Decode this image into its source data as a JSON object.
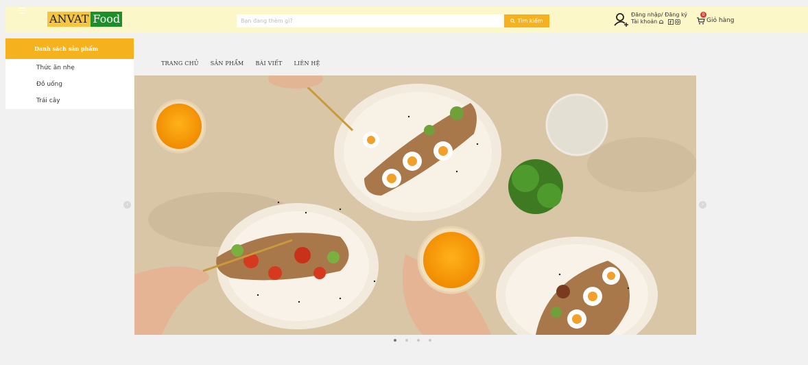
{
  "logo": {
    "part1": "ANVAT",
    "part2": "Food"
  },
  "search": {
    "placeholder": "Bạn đang thèm gì?",
    "button_label": "Tìm kiếm"
  },
  "account": {
    "login_label": "Đăng nhập/ Đăng ký",
    "account_label": "Tài khoản"
  },
  "cart": {
    "label": "Giỏ hàng",
    "count": "0"
  },
  "sidebar": {
    "title": "Danh sách sản phẩm",
    "items": [
      {
        "label": "Thức ăn nhẹ"
      },
      {
        "label": "Đồ uống"
      },
      {
        "label": "Trái cây"
      }
    ]
  },
  "nav": {
    "items": [
      {
        "label": "TRANG CHỦ"
      },
      {
        "label": "SẢN PHẨM"
      },
      {
        "label": "BÀI VIẾT"
      },
      {
        "label": "LIÊN HỆ"
      }
    ]
  },
  "carousel": {
    "slide_count": 4,
    "active_slide": 1
  },
  "colors": {
    "header_bg": "#fbf7c9",
    "accent": "#f5b21e",
    "logo_green": "#1d8f2a",
    "page_bg": "#f1f1f1"
  }
}
